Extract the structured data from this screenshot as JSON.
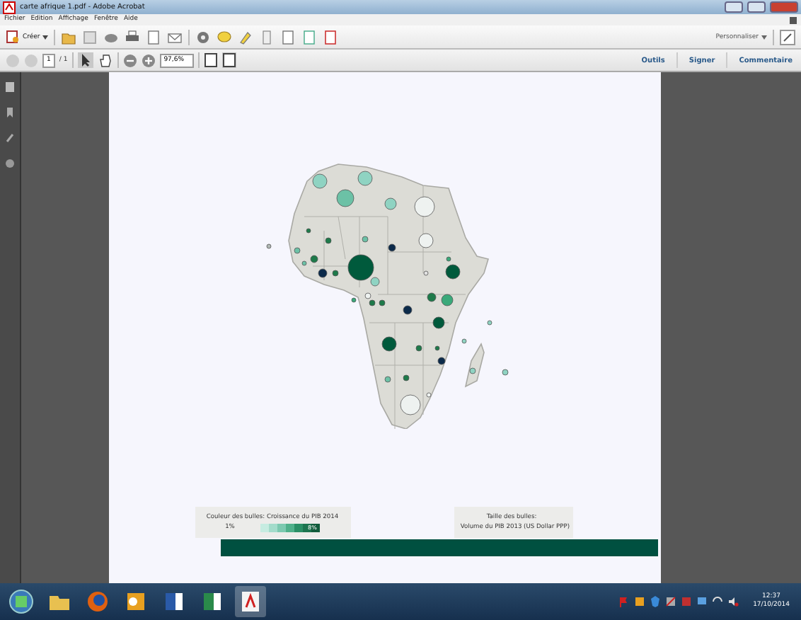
{
  "window": {
    "title": "carte afrique 1.pdf - Adobe Acrobat"
  },
  "menu": [
    "Fichier",
    "Edition",
    "Affichage",
    "Fenêtre",
    "Aide"
  ],
  "toolbar": {
    "create": "Créer",
    "customize": "Personnaliser"
  },
  "nav": {
    "page": "1",
    "pages": "/ 1",
    "zoom": "97,6%"
  },
  "panels": [
    {
      "label": "Outils"
    },
    {
      "label": "Signer"
    },
    {
      "label": "Commentaire"
    }
  ],
  "legend": {
    "color_title": "Couleur des bulles: Croissance du PIB 2014",
    "min": "1%",
    "max": "8%",
    "size_title": "Taille des bulles:",
    "size_subtitle": "Volume du PIB 2013 (US Dollar PPP)"
  },
  "clock": {
    "time": "12:37",
    "date": "17/10/2014"
  }
}
